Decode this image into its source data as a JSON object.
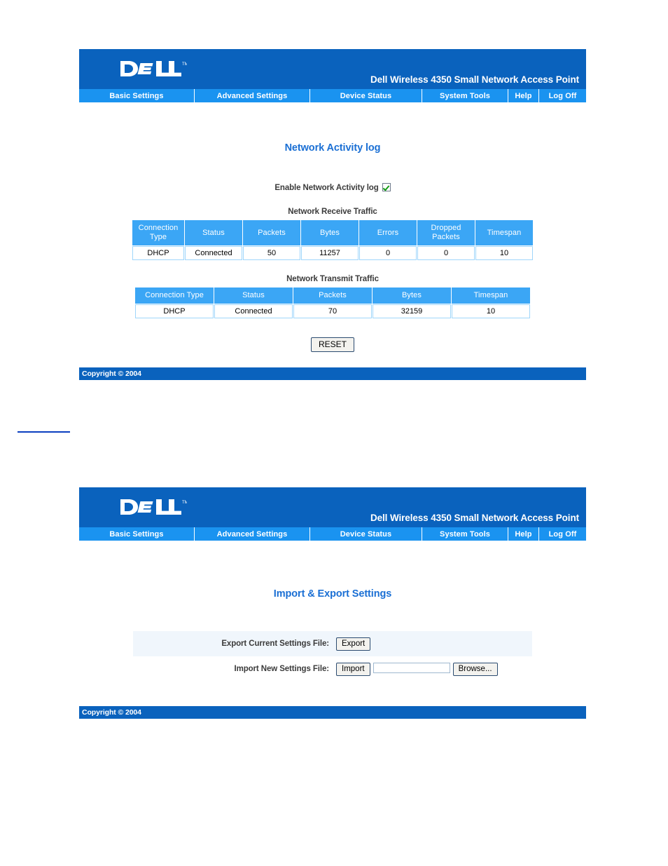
{
  "header": {
    "logo_alt": "DELL",
    "logo_tm": "TM",
    "product_title": "Dell Wireless 4350 Small Network Access Point"
  },
  "nav": {
    "items": [
      {
        "label": "Basic Settings"
      },
      {
        "label": "Advanced Settings"
      },
      {
        "label": "Device Status"
      },
      {
        "label": "System Tools"
      },
      {
        "label": "Help"
      },
      {
        "label": "Log Off"
      }
    ]
  },
  "footer": {
    "copyright": "Copyright © 2004"
  },
  "activity_page": {
    "title": "Network Activity log",
    "enable_label": "Enable Network Activity log",
    "enable_checked": true,
    "receive": {
      "caption": "Network Receive Traffic",
      "columns": [
        "Connection Type",
        "Status",
        "Packets",
        "Bytes",
        "Errors",
        "Dropped Packets",
        "Timespan"
      ],
      "rows": [
        [
          "DHCP",
          "Connected",
          "50",
          "11257",
          "0",
          "0",
          "10"
        ]
      ]
    },
    "transmit": {
      "caption": "Network Transmit Traffic",
      "columns": [
        "Connection Type",
        "Status",
        "Packets",
        "Bytes",
        "Timespan"
      ],
      "rows": [
        [
          "DHCP",
          "Connected",
          "70",
          "32159",
          "10"
        ]
      ]
    },
    "reset_label": "RESET"
  },
  "import_export_page": {
    "title": "Import & Export Settings",
    "export_label": "Export Current Settings File:",
    "export_button": "Export",
    "import_label": "Import New Settings File:",
    "import_button": "Import",
    "browse_button": "Browse...",
    "file_value": "",
    "file_placeholder": ""
  },
  "colors": {
    "banner_blue": "#0a62bd",
    "nav_blue": "#1a93f0",
    "table_header_blue": "#3ba6f5",
    "title_blue": "#1a6fd4",
    "row_shade": "#f0f6fc"
  }
}
